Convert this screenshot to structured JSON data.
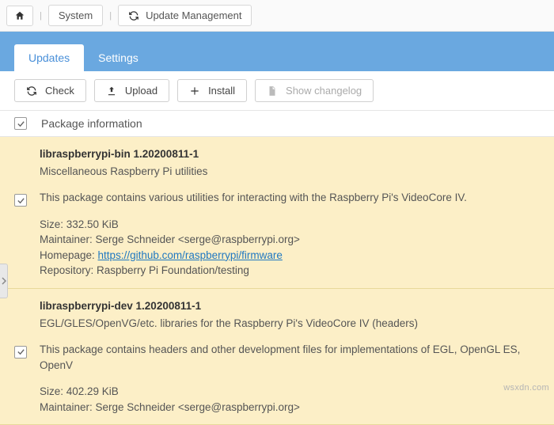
{
  "breadcrumb": {
    "home_icon": "home",
    "items": [
      "System",
      "Update Management"
    ],
    "refresh_icon": "refresh"
  },
  "tabs": {
    "items": [
      {
        "label": "Updates",
        "active": true
      },
      {
        "label": "Settings",
        "active": false
      }
    ]
  },
  "toolbar": {
    "check": {
      "label": "Check",
      "icon": "refresh"
    },
    "upload": {
      "label": "Upload",
      "icon": "upload"
    },
    "install": {
      "label": "Install",
      "icon": "plus"
    },
    "changelog": {
      "label": "Show changelog",
      "icon": "file",
      "disabled": true
    }
  },
  "columns": {
    "info": "Package information"
  },
  "packages": [
    {
      "title": "libraspberrypi-bin 1.20200811-1",
      "summary": "Miscellaneous Raspberry Pi utilities",
      "description": "This package contains various utilities for interacting with the Raspberry Pi's VideoCore IV.",
      "size_label": "Size: 332.50 KiB",
      "maintainer_label": "Maintainer: Serge Schneider <serge@raspberrypi.org>",
      "homepage_prefix": "Homepage: ",
      "homepage_url": "https://github.com/raspberrypi/firmware",
      "repository_label": "Repository: Raspberry Pi Foundation/testing",
      "checked": true
    },
    {
      "title": "libraspberrypi-dev 1.20200811-1",
      "summary": "EGL/GLES/OpenVG/etc. libraries for the Raspberry Pi's VideoCore IV (headers)",
      "description": "This package contains headers and other development files for implementations of EGL, OpenGL ES, OpenV",
      "size_label": "Size: 402.29 KiB",
      "maintainer_label": "Maintainer: Serge Schneider <serge@raspberrypi.org>",
      "checked": true
    }
  ],
  "watermark": "wsxdn.com"
}
